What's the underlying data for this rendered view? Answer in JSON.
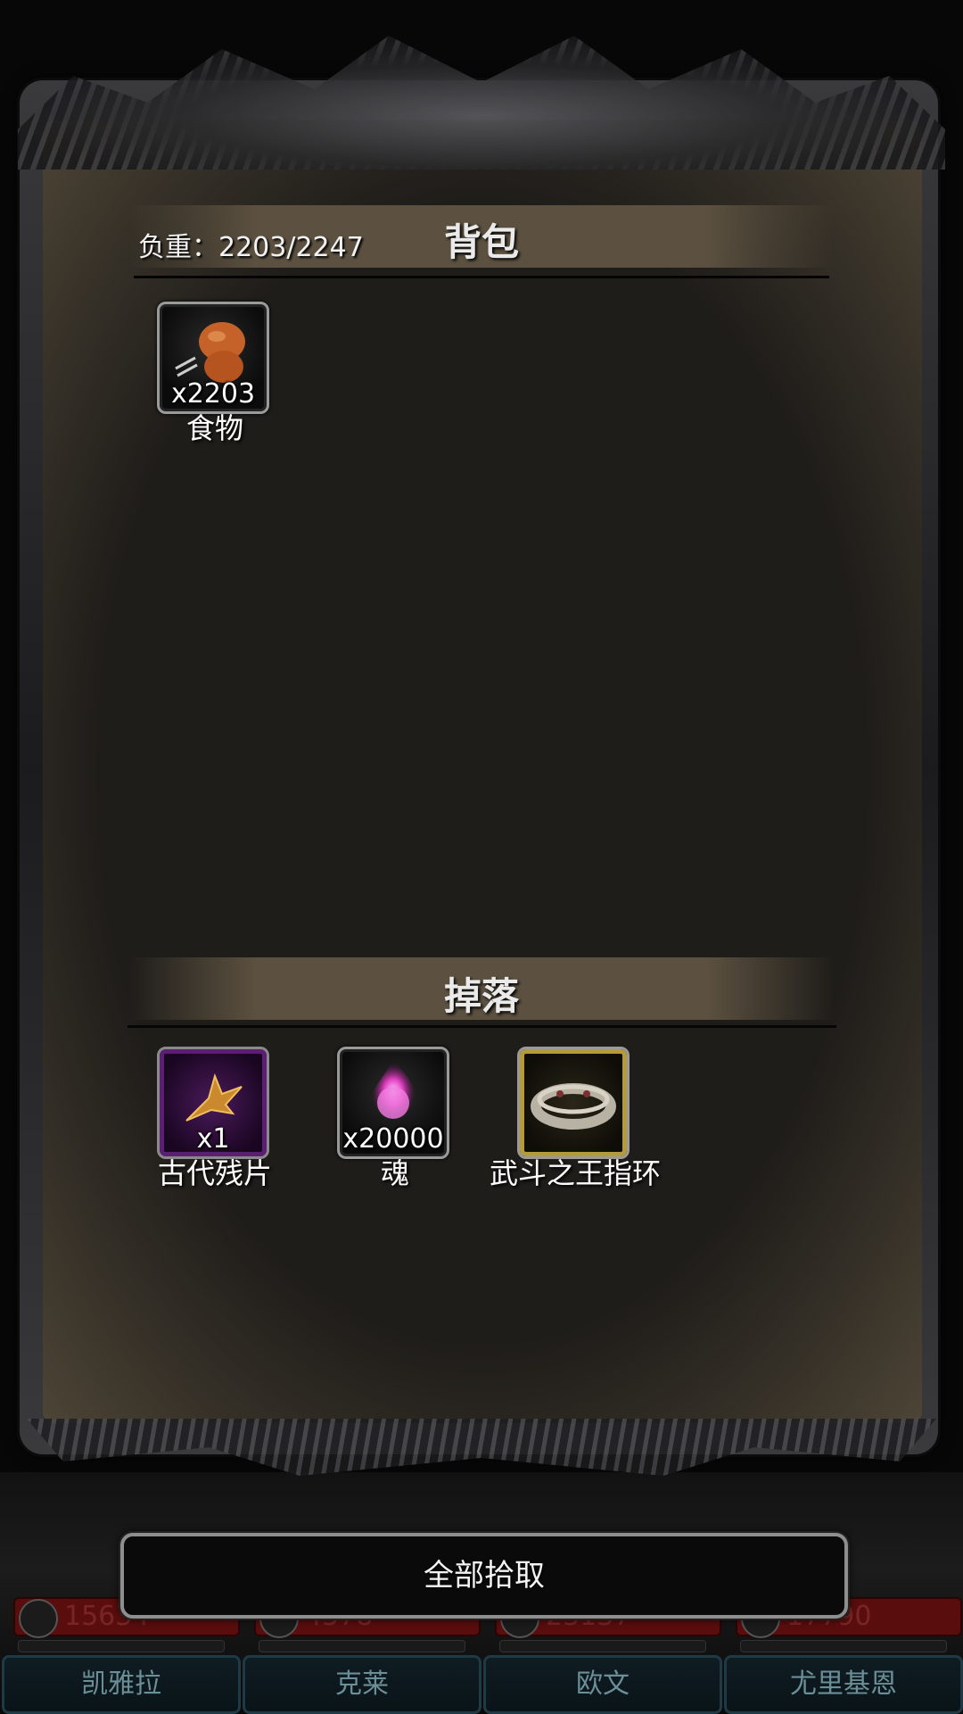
{
  "backpack": {
    "title": "背包",
    "weight_label": "负重：2203/2247",
    "items": [
      {
        "name": "食物",
        "qty": "x2203",
        "icon": "food-icon"
      }
    ]
  },
  "drops": {
    "title": "掉落",
    "items": [
      {
        "name": "古代残片",
        "qty": "x1",
        "icon": "ancient-fragment-icon",
        "rarity_color": "#5b1e74"
      },
      {
        "name": "魂",
        "qty": "x20000",
        "icon": "soul-icon"
      },
      {
        "name": "武斗之王指环",
        "qty": "",
        "icon": "ring-icon",
        "rarity_color": "#b49a38"
      }
    ]
  },
  "actions": {
    "pick_all": "全部拾取"
  },
  "party": [
    {
      "name": "凯雅拉",
      "hp": "15634"
    },
    {
      "name": "克莱",
      "hp": "4578"
    },
    {
      "name": "欧文",
      "hp": "23137"
    },
    {
      "name": "尤里基恩",
      "hp": "17790"
    }
  ]
}
